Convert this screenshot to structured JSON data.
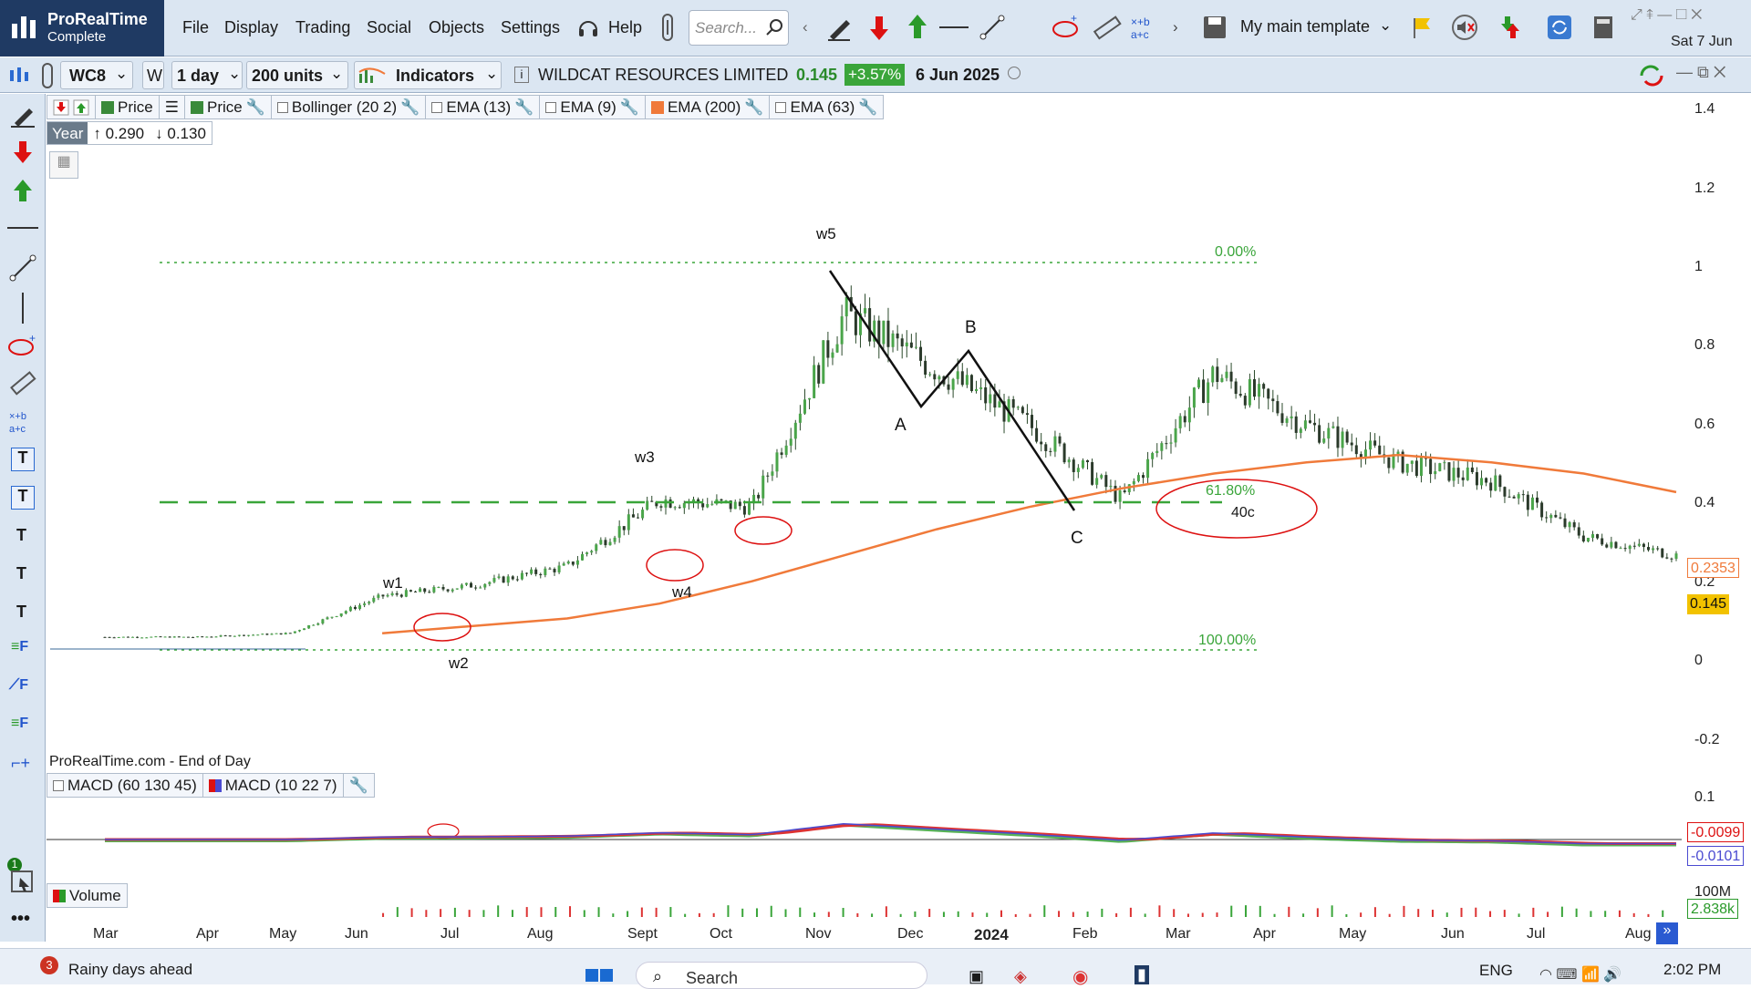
{
  "app": {
    "name": "ProRealTime",
    "edition": "Complete"
  },
  "menu": [
    "File",
    "Display",
    "Trading",
    "Social",
    "Objects",
    "Settings"
  ],
  "help_label": "Help",
  "search": {
    "placeholder": "Search..."
  },
  "template_label": "My main template",
  "corner_date": "Sat 7 Jun",
  "toolbar2": {
    "symbol": "WC8",
    "period_letter": "W",
    "interval": "1 day",
    "units": "200 units",
    "indicators": "Indicators",
    "instrument": "WILDCAT RESOURCES LIMITED",
    "price": "0.145",
    "change": "+3.57%",
    "date": "6 Jun 2025"
  },
  "indicators_bar": [
    {
      "label": "Price",
      "color": "#3a8a3a"
    },
    {
      "label": "Price",
      "color": "#3a8a3a"
    },
    {
      "label": "Bollinger (20 2)",
      "color": ""
    },
    {
      "label": "EMA (13)",
      "color": ""
    },
    {
      "label": "EMA (9)",
      "color": ""
    },
    {
      "label": "EMA (200)",
      "color": "#f07a3a"
    },
    {
      "label": "EMA (63)",
      "color": ""
    }
  ],
  "range_box": {
    "period": "Year",
    "high": "0.290",
    "low": "0.130"
  },
  "footer_label": "ProRealTime.com - End of Day",
  "macd_bar": [
    {
      "label": "MACD (60 130 45)"
    },
    {
      "label": "MACD (10 22 7)"
    }
  ],
  "volume_label": "Volume",
  "price_axis": [
    "1.4",
    "1.2",
    "1",
    "0.8",
    "0.6",
    "0.4",
    "0.2",
    "0",
    "-0.2"
  ],
  "price_boxes": {
    "ema": "0.2353",
    "last": "0.145"
  },
  "macd_axis": {
    "top": "0.1",
    "v1": "-0.0099",
    "v2": "-0.0101"
  },
  "volume_axis": {
    "top": "100M",
    "value": "2.838k"
  },
  "time_axis": [
    "Mar",
    "Apr",
    "May",
    "Jun",
    "Jul",
    "Aug",
    "Sept",
    "Oct",
    "Nov",
    "Dec",
    "2024",
    "Feb",
    "Mar",
    "Apr",
    "May",
    "Jun",
    "Jul",
    "Aug"
  ],
  "annotations": {
    "w1": "w1",
    "w2": "w2",
    "w3": "w3",
    "w4": "w4",
    "w5": "w5",
    "A": "A",
    "B": "B",
    "C": "C",
    "fib0": "0.00%",
    "fib618": "61.80%",
    "fib100": "100.00%",
    "target": "40c"
  },
  "chart_data": {
    "type": "line",
    "x": [
      "Mar",
      "Apr",
      "May",
      "Jun",
      "Jul",
      "Aug",
      "Sept",
      "Oct",
      "Nov",
      "Dec",
      "2024",
      "Feb",
      "Mar",
      "Apr",
      "May",
      "Jun",
      "Jul",
      "Aug"
    ],
    "series": [
      {
        "values": [
          0.03,
          0.03,
          0.04,
          0.14,
          0.17,
          0.22,
          0.4,
          0.38,
          0.9,
          0.75,
          0.6,
          0.4,
          0.74,
          0.6,
          0.5,
          0.45,
          0.3,
          0.25
        ]
      },
      {
        "name": "EMA (200)",
        "values": [
          null,
          null,
          null,
          0.04,
          0.06,
          0.08,
          0.12,
          0.18,
          0.25,
          0.32,
          0.38,
          0.43,
          0.47,
          0.5,
          0.52,
          0.5,
          0.47,
          0.42
        ]
      }
    ],
    "ylim": [
      -0.25,
      1.45
    ],
    "grid": false
  },
  "taskbar": {
    "notification_count": "3",
    "notification": "Rainy days ahead",
    "search": "Search",
    "lang": "ENG",
    "time": "2:02 PM"
  },
  "colors": {
    "accent": "#1f3a63",
    "ema200": "#f07a3a",
    "fib": "#3aa53a",
    "change_bg": "#3aa53a"
  }
}
